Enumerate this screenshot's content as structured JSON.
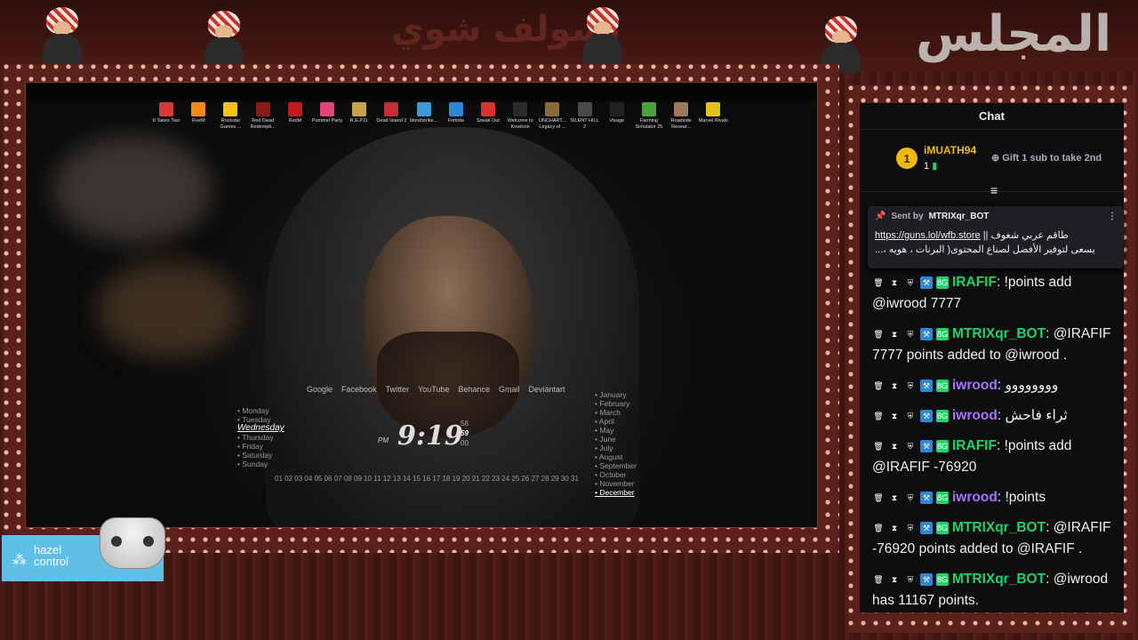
{
  "banner": {
    "title": "المجلس",
    "subtitle": "نسولف شوي"
  },
  "desktop": {
    "icons": [
      {
        "label": "It Takes Two",
        "color": "#d63a3a"
      },
      {
        "label": "FiveM",
        "color": "#f28a1b"
      },
      {
        "label": "Rockstar Games ...",
        "color": "#f2c21b"
      },
      {
        "label": "Red Dead Redempti...",
        "color": "#8a1a1a"
      },
      {
        "label": "RedM",
        "color": "#c21a1a"
      },
      {
        "label": "Pummel Party",
        "color": "#e0457a"
      },
      {
        "label": "R.E.P.O.",
        "color": "#c8a24a"
      },
      {
        "label": "Dead Island 2",
        "color": "#c22f3a"
      },
      {
        "label": "bloodstrike...",
        "color": "#3a9ad6"
      },
      {
        "label": "Fortnite",
        "color": "#2f86d6"
      },
      {
        "label": "Sneak Out",
        "color": "#d6322f"
      },
      {
        "label": "Welcome to Kowloon",
        "color": "#2b2b2b"
      },
      {
        "label": "UNCHART... Legacy of ...",
        "color": "#8a6a3a"
      },
      {
        "label": "SILENT HILL 2",
        "color": "#4a4a4a"
      },
      {
        "label": "Visage",
        "color": "#222222"
      },
      {
        "label": "Farming Simulator 25",
        "color": "#4aa33a"
      },
      {
        "label": "Roadside Resear...",
        "color": "#9a7a5a"
      },
      {
        "label": "Marvel Rivals",
        "color": "#e0c21a"
      }
    ],
    "links": [
      "Google",
      "Facebook",
      "Twitter",
      "YouTube",
      "Behance",
      "Gmail",
      "Deviantart"
    ],
    "days": [
      "Monday",
      "Tuesday",
      "Wednesday",
      "Thursday",
      "Friday",
      "Saturday",
      "Sunday"
    ],
    "selected_day": "Wednesday",
    "clock": {
      "time": "9:19",
      "ampm": "PM",
      "seconds": [
        "58",
        "59",
        "00"
      ]
    },
    "dates": "01 02 03 04 05 06 07 08 09 10 11 12 13 14 15 16 17 18 19 20 21 22 23 24 25 26 27 28 29 30 31",
    "months": [
      "January",
      "February",
      "March",
      "April",
      "May",
      "June",
      "July",
      "August",
      "September",
      "October",
      "November",
      "December"
    ],
    "selected_month": "December"
  },
  "hazel": {
    "line1": "hazel",
    "line2": "control"
  },
  "chat": {
    "header": "Chat",
    "leader": {
      "rank": "1",
      "name": "iMUATH94",
      "count": "1"
    },
    "gift": "Gift 1 sub to take 2nd",
    "pinned": {
      "sent_by": "Sent by",
      "bot": "MTRIXqr_BOT",
      "line1_link": "https://guns.lol/wfb.store",
      "line1_text": "طاقم عربي شغوف ||",
      "line2": "يسعى لتوفير الأفضل لصناع المحتوى( البرنات ، هويه ،..."
    },
    "messages": [
      {
        "user": "IRAFIF",
        "color": "#1fd36a",
        "text": "!points add @iwrood 7777"
      },
      {
        "user": "MTRIXqr_BOT",
        "color": "#1fd36a",
        "text": "@IRAFIF 7777 points added to @iwrood ."
      },
      {
        "user": "iwrood",
        "color": "#a970ff",
        "text": "وووووووو"
      },
      {
        "user": "iwrood",
        "color": "#a970ff",
        "text": "ثراء فاحش"
      },
      {
        "user": "IRAFIF",
        "color": "#1fd36a",
        "text": "!points add @IRAFIF -76920"
      },
      {
        "user": "iwrood",
        "color": "#a970ff",
        "text": "!points"
      },
      {
        "user": "MTRIXqr_BOT",
        "color": "#1fd36a",
        "text": "@IRAFIF -76920 points added to @IRAFIF ."
      },
      {
        "user": "MTRIXqr_BOT",
        "color": "#1fd36a",
        "text": "@iwrood has 11167 points."
      }
    ]
  }
}
